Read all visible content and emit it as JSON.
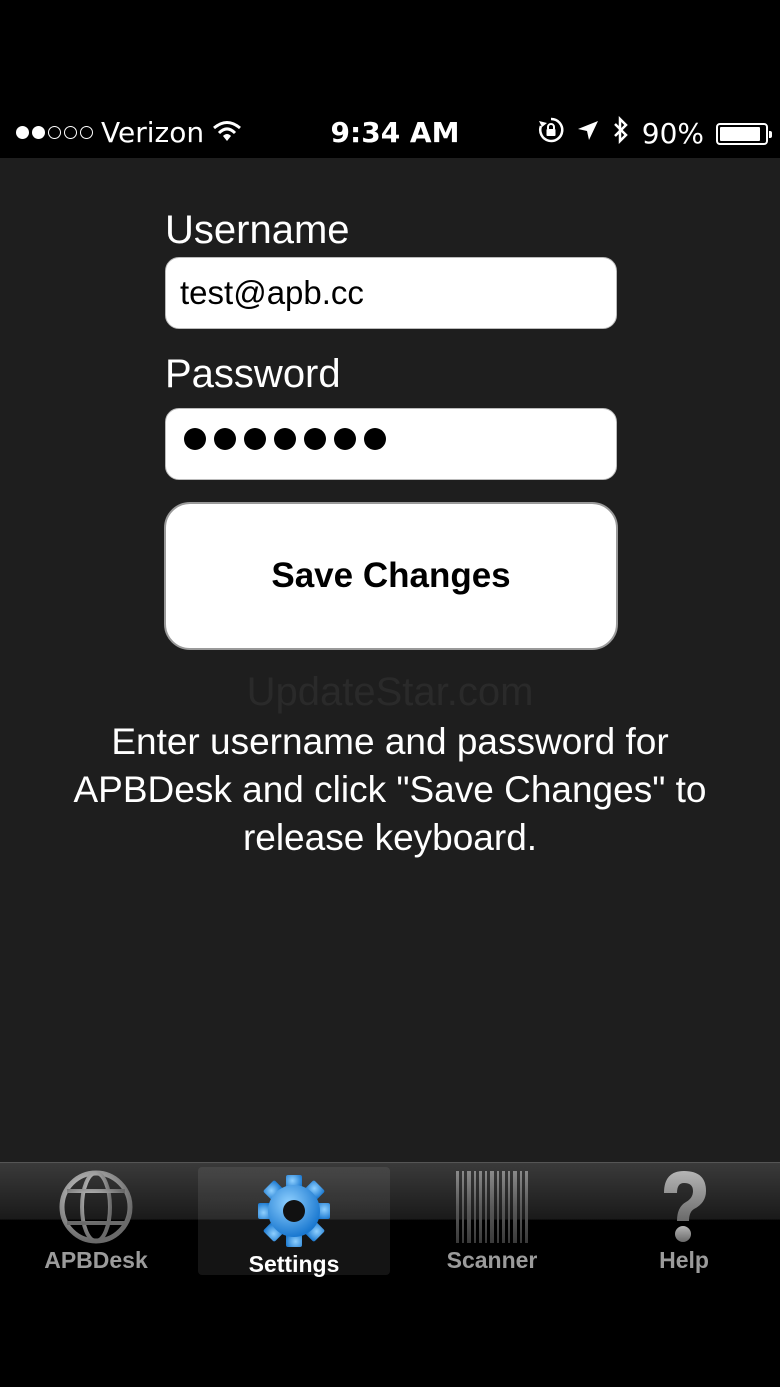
{
  "status_bar": {
    "carrier": "Verizon",
    "signal_strength": 2,
    "signal_max": 5,
    "time": "9:34 AM",
    "battery_percent": "90%",
    "battery_level": 0.9
  },
  "form": {
    "username_label": "Username",
    "username_value": "test@apb.cc",
    "password_label": "Password",
    "password_length": 7,
    "save_button_label": "Save Changes"
  },
  "watermark": "UpdateStar.com",
  "instructions": "Enter username and password for APBDesk and click \"Save Changes\" to release keyboard.",
  "tab_bar": {
    "tabs": [
      {
        "label": "APBDesk",
        "icon": "globe-icon",
        "selected": false
      },
      {
        "label": "Settings",
        "icon": "gear-icon",
        "selected": true
      },
      {
        "label": "Scanner",
        "icon": "barcode-icon",
        "selected": false
      },
      {
        "label": "Help",
        "icon": "question-mark-icon",
        "selected": false
      }
    ]
  },
  "colors": {
    "background": "#1e1e1e",
    "accent_selected_icon": "#2b8fe0"
  }
}
